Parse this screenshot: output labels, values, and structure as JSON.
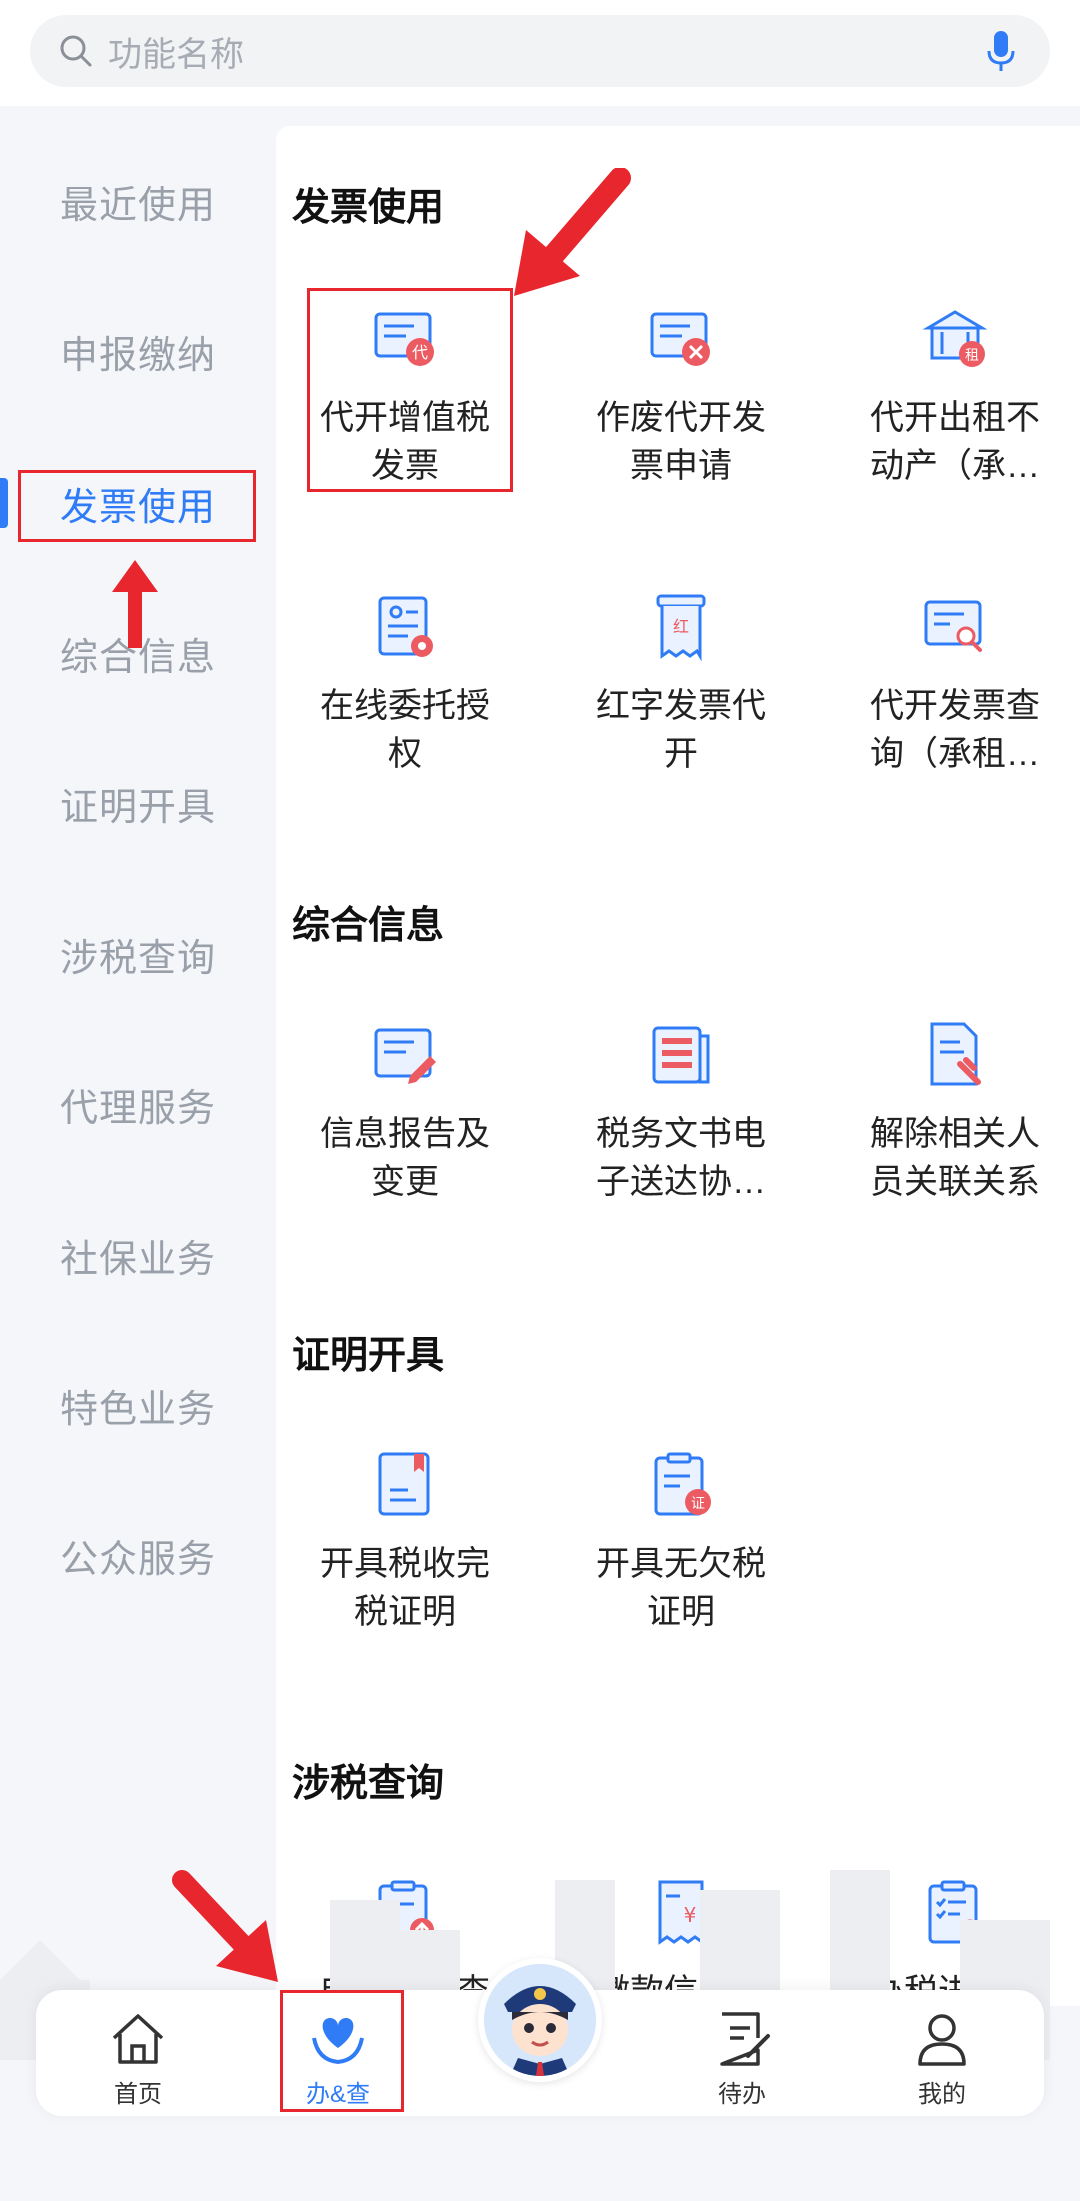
{
  "search": {
    "placeholder": "功能名称",
    "icon": "search-icon",
    "mic_icon": "microphone-icon"
  },
  "sidebar": {
    "items": [
      {
        "label": "最近使用"
      },
      {
        "label": "申报缴纳"
      },
      {
        "label": "发票使用",
        "active": true
      },
      {
        "label": "综合信息"
      },
      {
        "label": "证明开具"
      },
      {
        "label": "涉税查询"
      },
      {
        "label": "代理服务"
      },
      {
        "label": "社保业务"
      },
      {
        "label": "特色业务"
      },
      {
        "label": "公众服务"
      }
    ]
  },
  "sections": {
    "invoice": {
      "title": "发票使用",
      "items": [
        {
          "label_line1": "代开增值税",
          "label_line2": "发票",
          "icon": "issue-invoice-icon"
        },
        {
          "label_line1": "作废代开发",
          "label_line2": "票申请",
          "icon": "void-invoice-icon"
        },
        {
          "label_line1": "代开出租不",
          "label_line2": "动产（承…",
          "icon": "rental-property-icon"
        },
        {
          "label_line1": "在线委托授",
          "label_line2": "权",
          "icon": "online-authorization-icon"
        },
        {
          "label_line1": "红字发票代",
          "label_line2": "开",
          "icon": "red-invoice-icon"
        },
        {
          "label_line1": "代开发票查",
          "label_line2": "询（承租…",
          "icon": "invoice-query-icon"
        }
      ]
    },
    "info": {
      "title": "综合信息",
      "items": [
        {
          "label_line1": "信息报告及",
          "label_line2": "变更",
          "icon": "info-report-edit-icon"
        },
        {
          "label_line1": "税务文书电",
          "label_line2": "子送达协…",
          "icon": "tax-document-icon"
        },
        {
          "label_line1": "解除相关人",
          "label_line2": "员关联关系",
          "icon": "unlink-person-icon"
        }
      ]
    },
    "certificate": {
      "title": "证明开具",
      "items": [
        {
          "label_line1": "开具税收完",
          "label_line2": "税证明",
          "icon": "tax-paid-certificate-icon"
        },
        {
          "label_line1": "开具无欠税",
          "label_line2": "证明",
          "icon": "no-arrears-certificate-icon"
        }
      ]
    },
    "query": {
      "title": "涉税查询",
      "items": [
        {
          "label_line1": "申报信息查",
          "icon": "declaration-query-icon"
        },
        {
          "label_line1": "缴款信息查",
          "icon": "payment-query-icon"
        },
        {
          "label_line1": "办税进度及",
          "icon": "progress-query-icon"
        }
      ]
    }
  },
  "nav": {
    "home": "首页",
    "handle": "办&查",
    "todo": "待办",
    "mine": "我的"
  },
  "colors": {
    "accent": "#2f7cf6",
    "annotation": "#e8262e"
  }
}
